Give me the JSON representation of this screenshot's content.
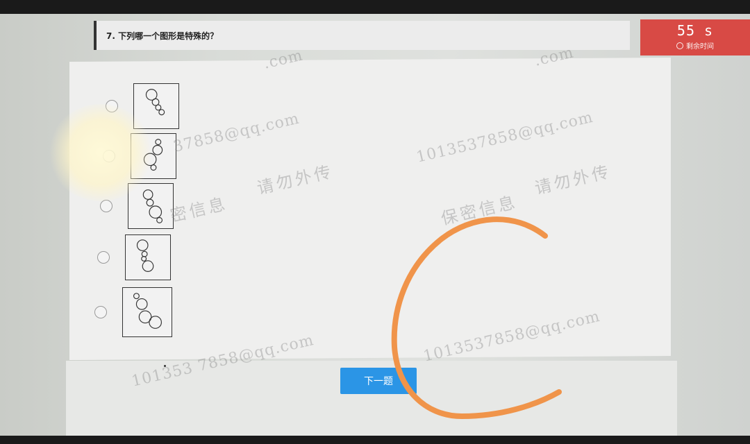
{
  "question": {
    "text": "7.  下列哪一个图形是特殊的？"
  },
  "timer": {
    "value": "55 s",
    "label": "剩余时间"
  },
  "options": [
    {
      "id": "A"
    },
    {
      "id": "B"
    },
    {
      "id": "C"
    },
    {
      "id": "D"
    },
    {
      "id": "E"
    }
  ],
  "next_button": {
    "label": "下一题"
  },
  "watermark": {
    "email": "1013537858@qq.com",
    "email_partial_1": ".com",
    "email_partial_2": "37858@qq.com",
    "email_partial_3": "1013537858@qq.com",
    "email_partial_4": "101353 7858@qq.com",
    "email_partial_5": "1013537858@qq.com",
    "secret_1": "保密信息",
    "secret_2": "请勿外传",
    "secret_partial": "密信息"
  },
  "colors": {
    "timer_bg": "#d84a45",
    "button_bg": "#2b95e6",
    "annotation": "#f0944a"
  },
  "icons": {
    "timer": "clock-icon",
    "option": "radio-button"
  }
}
